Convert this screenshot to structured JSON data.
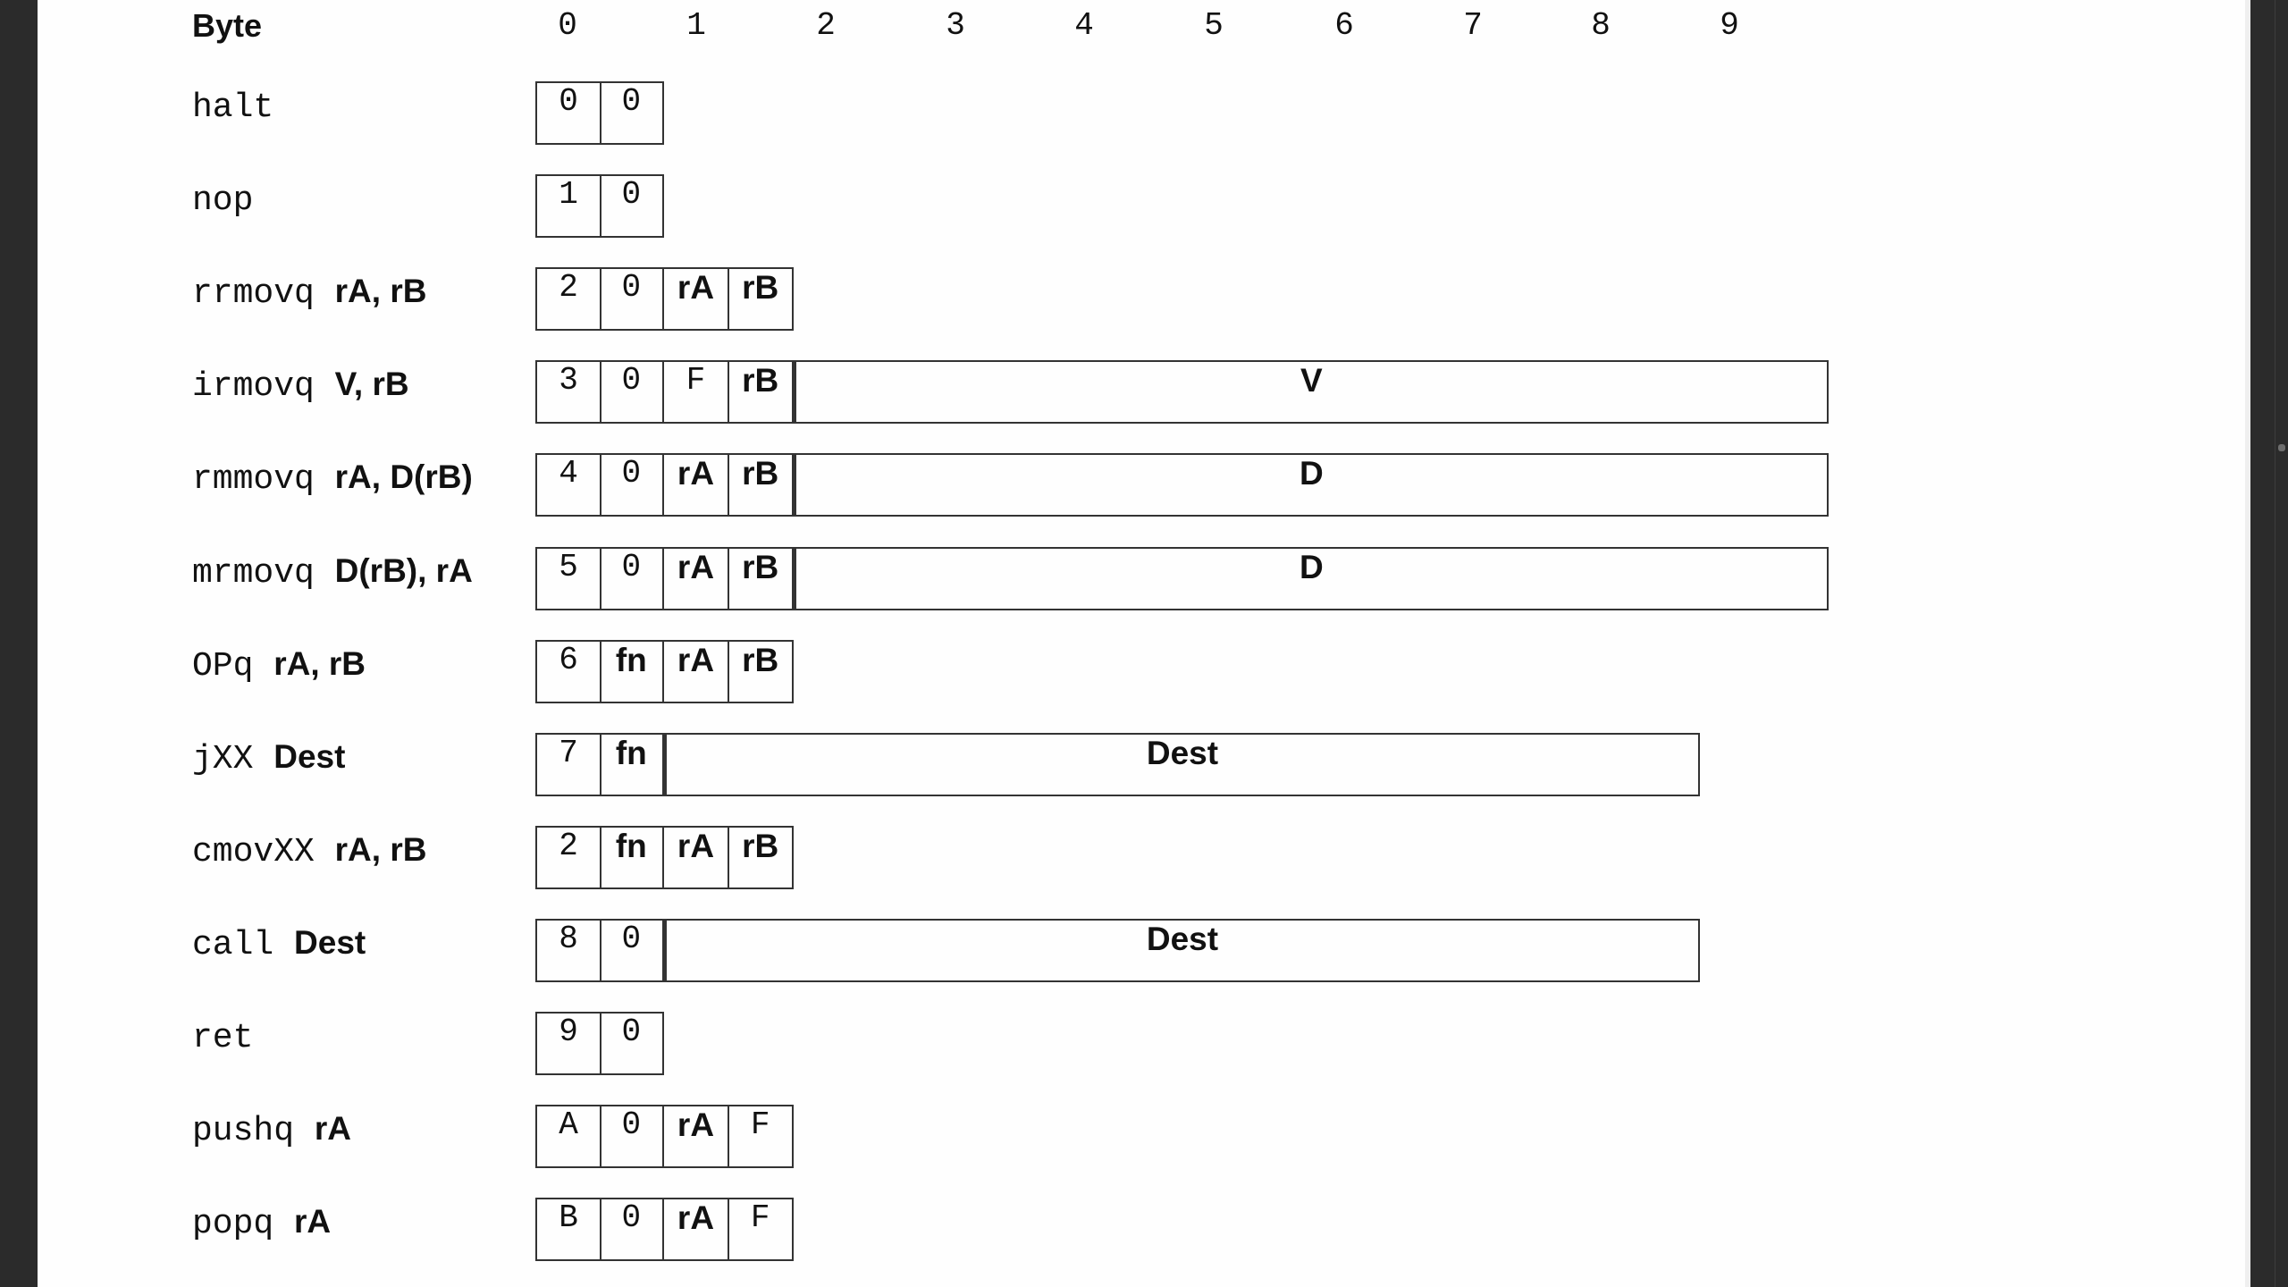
{
  "header": {
    "label": "Byte",
    "columns": [
      "0",
      "1",
      "2",
      "3",
      "4",
      "5",
      "6",
      "7",
      "8",
      "9"
    ]
  },
  "rows": [
    {
      "mnemonic": "halt",
      "operands": "",
      "cells": [
        {
          "t": "0",
          "s": "mono",
          "w": 1
        },
        {
          "t": "0",
          "s": "mono",
          "w": 1
        }
      ]
    },
    {
      "mnemonic": "nop",
      "operands": "",
      "cells": [
        {
          "t": "1",
          "s": "mono",
          "w": 1
        },
        {
          "t": "0",
          "s": "mono",
          "w": 1
        }
      ]
    },
    {
      "mnemonic": "rrmovq ",
      "operands": "rA, rB",
      "cells": [
        {
          "t": "2",
          "s": "mono",
          "w": 1
        },
        {
          "t": "0",
          "s": "mono",
          "w": 1
        },
        {
          "t": "rA",
          "s": "bold",
          "w": 1
        },
        {
          "t": "rB",
          "s": "bold",
          "w": 1
        }
      ]
    },
    {
      "mnemonic": "irmovq ",
      "operands": "V, rB",
      "cells": [
        {
          "t": "3",
          "s": "mono",
          "w": 1
        },
        {
          "t": "0",
          "s": "mono",
          "w": 1
        },
        {
          "t": "F",
          "s": "mono",
          "w": 1
        },
        {
          "t": "rB",
          "s": "bold",
          "w": 1
        },
        {
          "t": "V",
          "s": "bold",
          "w": 16
        }
      ]
    },
    {
      "mnemonic": "rmmovq ",
      "operands": "rA, D(rB)",
      "cells": [
        {
          "t": "4",
          "s": "mono",
          "w": 1
        },
        {
          "t": "0",
          "s": "mono",
          "w": 1
        },
        {
          "t": "rA",
          "s": "bold",
          "w": 1
        },
        {
          "t": "rB",
          "s": "bold",
          "w": 1
        },
        {
          "t": "D",
          "s": "bold",
          "w": 16
        }
      ]
    },
    {
      "mnemonic": "mrmovq ",
      "operands": "D(rB), rA",
      "cells": [
        {
          "t": "5",
          "s": "mono",
          "w": 1
        },
        {
          "t": "0",
          "s": "mono",
          "w": 1
        },
        {
          "t": "rA",
          "s": "bold",
          "w": 1
        },
        {
          "t": "rB",
          "s": "bold",
          "w": 1
        },
        {
          "t": "D",
          "s": "bold",
          "w": 16
        }
      ]
    },
    {
      "mnemonic": "OPq ",
      "operands": "rA, rB",
      "cells": [
        {
          "t": "6",
          "s": "mono",
          "w": 1
        },
        {
          "t": "fn",
          "s": "bold",
          "w": 1
        },
        {
          "t": "rA",
          "s": "bold",
          "w": 1
        },
        {
          "t": "rB",
          "s": "bold",
          "w": 1
        }
      ]
    },
    {
      "mnemonic": "jXX ",
      "operands": "Dest",
      "cells": [
        {
          "t": "7",
          "s": "mono",
          "w": 1
        },
        {
          "t": "fn",
          "s": "bold",
          "w": 1
        },
        {
          "t": "Dest",
          "s": "bold",
          "w": 16
        }
      ]
    },
    {
      "mnemonic": "cmovXX ",
      "operands": "rA, rB",
      "cells": [
        {
          "t": "2",
          "s": "mono",
          "w": 1
        },
        {
          "t": "fn",
          "s": "bold",
          "w": 1
        },
        {
          "t": "rA",
          "s": "bold",
          "w": 1
        },
        {
          "t": "rB",
          "s": "bold",
          "w": 1
        }
      ]
    },
    {
      "mnemonic": "call ",
      "operands": "Dest",
      "cells": [
        {
          "t": "8",
          "s": "mono",
          "w": 1
        },
        {
          "t": "0",
          "s": "mono",
          "w": 1
        },
        {
          "t": "Dest",
          "s": "bold",
          "w": 16
        }
      ]
    },
    {
      "mnemonic": "ret",
      "operands": "",
      "cells": [
        {
          "t": "9",
          "s": "mono",
          "w": 1
        },
        {
          "t": "0",
          "s": "mono",
          "w": 1
        }
      ]
    },
    {
      "mnemonic": "pushq ",
      "operands": "rA",
      "cells": [
        {
          "t": "A",
          "s": "mono",
          "w": 1
        },
        {
          "t": "0",
          "s": "mono",
          "w": 1
        },
        {
          "t": "rA",
          "s": "bold",
          "w": 1
        },
        {
          "t": "F",
          "s": "mono",
          "w": 1
        }
      ]
    },
    {
      "mnemonic": "popq ",
      "operands": "rA",
      "cells": [
        {
          "t": "B",
          "s": "mono",
          "w": 1
        },
        {
          "t": "0",
          "s": "mono",
          "w": 1
        },
        {
          "t": "rA",
          "s": "bold",
          "w": 1
        },
        {
          "t": "F",
          "s": "mono",
          "w": 1
        }
      ]
    }
  ]
}
